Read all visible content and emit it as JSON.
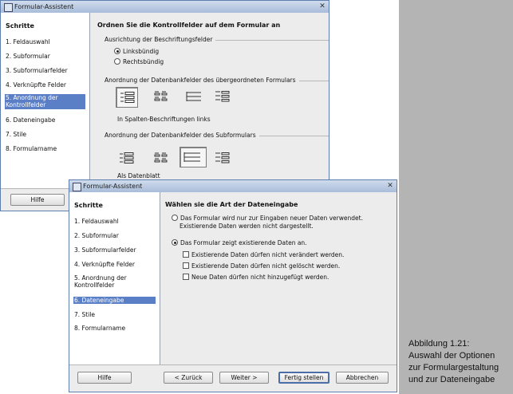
{
  "back_window": {
    "title": "Formular-Assistent",
    "sidebar_header": "Schritte",
    "steps": [
      "1. Feldauswahl",
      "2. Subformular",
      "3. Subformularfelder",
      "4. Verknüpfte Felder",
      "5. Anordnung der Kontrollfelder",
      "6. Dateneingabe",
      "7. Stile",
      "8. Formularname"
    ],
    "selected_step": 4,
    "main_title": "Ordnen Sie die Kontrollfelder auf dem Formular an",
    "label_alignment_group": "Ausrichtung der Beschriftungsfelder",
    "alignment_left": "Linksbündig",
    "alignment_right": "Rechtsbündig",
    "main_form_group": "Anordnung der Datenbankfelder des übergeordneten Formulars",
    "main_form_selected_label": "In Spalten-Beschriftungen links",
    "subform_group": "Anordnung der Datenbankfelder des Subformulars",
    "subform_selected_label": "Als Datenblatt",
    "help_button": "Hilfe"
  },
  "front_window": {
    "title": "Formular-Assistent",
    "sidebar_header": "Schritte",
    "steps": [
      "1. Feldauswahl",
      "2. Subformular",
      "3. Subformularfelder",
      "4. Verknüpfte Felder",
      "5. Anordnung der Kontrollfelder",
      "6. Dateneingabe",
      "7. Stile",
      "8. Formularname"
    ],
    "selected_step": 5,
    "main_title": "Wählen sie die Art der Dateneingabe",
    "option_new_only_line1": "Das Formular wird nur zur Eingaben neuer Daten verwendet.",
    "option_new_only_line2": "Existierende Daten werden nicht dargestellt.",
    "option_show_all": "Das Formular zeigt existierende Daten an.",
    "check_no_modify": "Existierende Daten dürfen nicht verändert werden.",
    "check_no_delete": "Existierende Daten dürfen nicht gelöscht werden.",
    "check_no_add": "Neue Daten dürfen nicht hinzugefügt werden.",
    "buttons": {
      "help": "Hilfe",
      "back": "< Zurück",
      "next": "Weiter >",
      "finish": "Fertig stellen",
      "cancel": "Abbrechen"
    }
  },
  "caption": {
    "line1": "Abbildung 1.21:",
    "line2": "Auswahl der Optionen",
    "line3": "zur Formulargestaltung",
    "line4": "und zur Dateneingabe"
  }
}
